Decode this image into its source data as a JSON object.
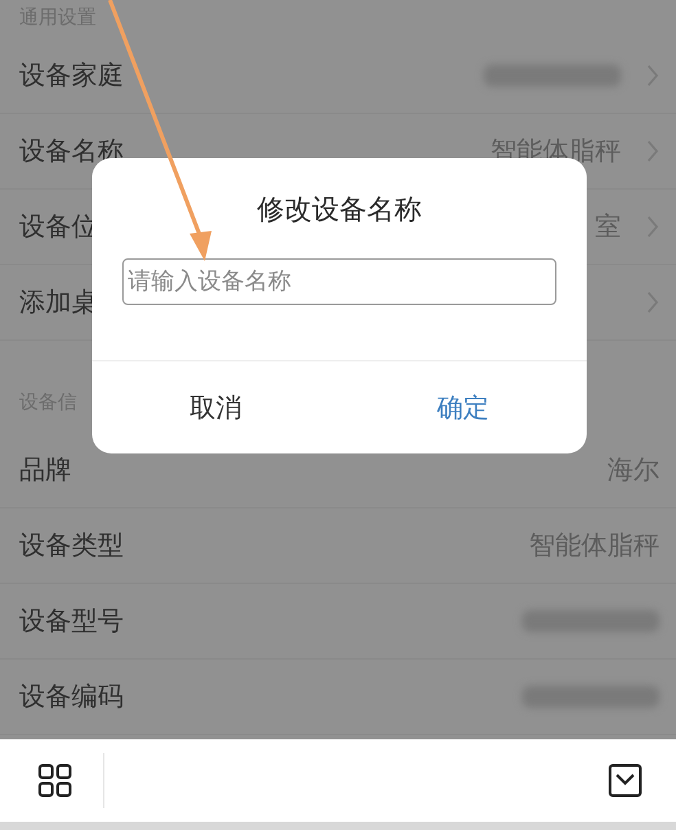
{
  "sections": [
    {
      "header": "通用设置",
      "rows": [
        {
          "label": "设备家庭",
          "value_redacted": true,
          "chevron": true
        },
        {
          "label": "设备名称",
          "value": "智能体脂秤",
          "chevron": true
        },
        {
          "label": "设备位",
          "value": "室",
          "chevron": true
        },
        {
          "label": "添加桌",
          "chevron": true
        }
      ]
    },
    {
      "header": "设备信",
      "rows": [
        {
          "label": "品牌",
          "value": "海尔",
          "chevron": false
        },
        {
          "label": "设备类型",
          "value": "智能体脂秤",
          "chevron": false
        },
        {
          "label": "设备型号",
          "value_redacted": true,
          "chevron": false
        },
        {
          "label": "设备编码",
          "value_redacted": true,
          "chevron": false
        }
      ]
    }
  ],
  "dialog": {
    "title": "修改设备名称",
    "input": {
      "placeholder": "请输入设备名称"
    },
    "buttons": [
      {
        "label": "取消",
        "kind": "cancel"
      },
      {
        "label": "确定",
        "kind": "confirm"
      }
    ]
  },
  "annotation": {
    "kind": "arrow"
  }
}
